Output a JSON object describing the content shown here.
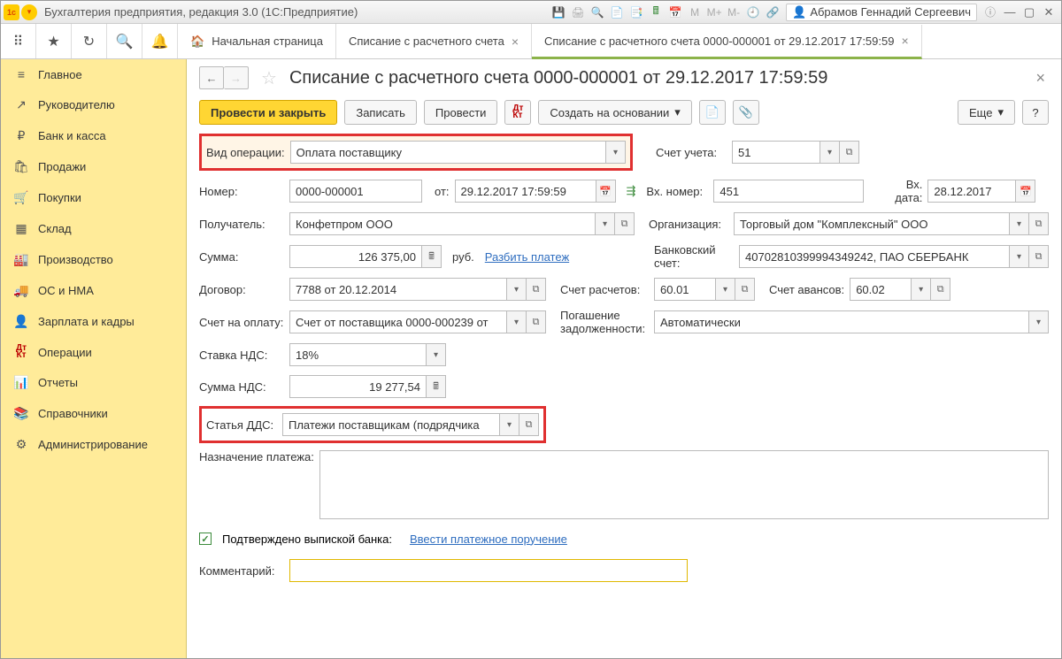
{
  "titlebar": {
    "app_title": "Бухгалтерия предприятия, редакция 3.0  (1С:Предприятие)",
    "user": "Абрамов Геннадий Сергеевич",
    "m_labels": [
      "M",
      "M+",
      "M-"
    ]
  },
  "toolbar_tabs": {
    "home": "Начальная страница",
    "t1": "Списание с расчетного счета",
    "t2": "Списание с расчетного счета 0000-000001 от 29.12.2017 17:59:59"
  },
  "nav": [
    {
      "icon": "≡",
      "label": "Главное"
    },
    {
      "icon": "↗",
      "label": "Руководителю"
    },
    {
      "icon": "₽",
      "label": "Банк и касса"
    },
    {
      "icon": "🛍",
      "label": "Продажи"
    },
    {
      "icon": "🛒",
      "label": "Покупки"
    },
    {
      "icon": "▦",
      "label": "Склад"
    },
    {
      "icon": "🏭",
      "label": "Производство"
    },
    {
      "icon": "🚚",
      "label": "ОС и НМА"
    },
    {
      "icon": "👤",
      "label": "Зарплата и кадры"
    },
    {
      "icon": "Дт/Кт",
      "label": "Операции"
    },
    {
      "icon": "📊",
      "label": "Отчеты"
    },
    {
      "icon": "📚",
      "label": "Справочники"
    },
    {
      "icon": "⚙",
      "label": "Администрирование"
    }
  ],
  "doc": {
    "title": "Списание с расчетного счета 0000-000001 от 29.12.2017 17:59:59",
    "cmd": {
      "post_close": "Провести и закрыть",
      "write": "Записать",
      "post": "Провести",
      "create_based": "Создать на основании",
      "more": "Еще",
      "help": "?"
    },
    "fields": {
      "op_kind_lbl": "Вид операции:",
      "op_kind": "Оплата поставщику",
      "acct_lbl": "Счет учета:",
      "acct": "51",
      "num_lbl": "Номер:",
      "num": "0000-000001",
      "from_lbl": "от:",
      "date": "29.12.2017 17:59:59",
      "in_num_lbl": "Вх. номер:",
      "in_num": "451",
      "in_date_lbl": "Вх. дата:",
      "in_date": "28.12.2017",
      "payee_lbl": "Получатель:",
      "payee": "Конфетпром ООО",
      "org_lbl": "Организация:",
      "org": "Торговый дом \"Комплексный\" ООО",
      "sum_lbl": "Сумма:",
      "sum": "126 375,00",
      "currency": "руб.",
      "split": "Разбить платеж",
      "bank_acc_lbl": "Банковский счет:",
      "bank_acc": "40702810399994349242, ПАО СБЕРБАНК",
      "contract_lbl": "Договор:",
      "contract": "7788 от 20.12.2014",
      "settle_acc_lbl": "Счет расчетов:",
      "settle_acc": "60.01",
      "adv_acc_lbl": "Счет авансов:",
      "adv_acc": "60.02",
      "pay_bill_lbl": "Счет на оплату:",
      "pay_bill": "Счет от поставщика 0000-000239 от",
      "debt_lbl": "Погашение задолженности:",
      "debt": "Автоматически",
      "vat_rate_lbl": "Ставка НДС:",
      "vat_rate": "18%",
      "vat_sum_lbl": "Сумма НДС:",
      "vat_sum": "19 277,54",
      "dds_lbl": "Статья ДДС:",
      "dds": "Платежи поставщикам (подрядчика",
      "purpose_lbl": "Назначение платежа:",
      "confirmed": "Подтверждено выпиской банка:",
      "enter_po": "Ввести платежное поручение",
      "comment_lbl": "Комментарий:",
      "comment": ""
    }
  }
}
